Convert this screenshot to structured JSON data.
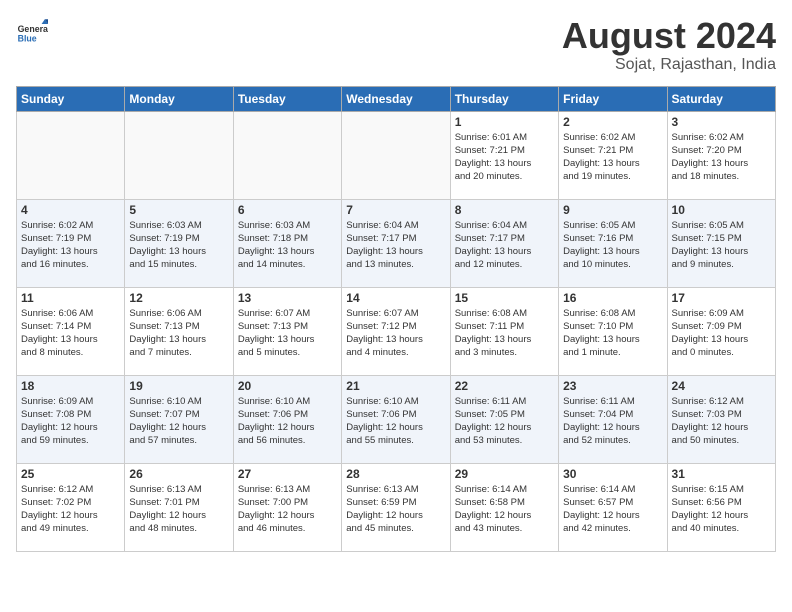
{
  "header": {
    "logo": {
      "general": "General",
      "blue": "Blue"
    },
    "title": "August 2024",
    "location": "Sojat, Rajasthan, India"
  },
  "days_of_week": [
    "Sunday",
    "Monday",
    "Tuesday",
    "Wednesday",
    "Thursday",
    "Friday",
    "Saturday"
  ],
  "weeks": [
    [
      {
        "day": "",
        "info": ""
      },
      {
        "day": "",
        "info": ""
      },
      {
        "day": "",
        "info": ""
      },
      {
        "day": "",
        "info": ""
      },
      {
        "day": "1",
        "info": "Sunrise: 6:01 AM\nSunset: 7:21 PM\nDaylight: 13 hours\nand 20 minutes."
      },
      {
        "day": "2",
        "info": "Sunrise: 6:02 AM\nSunset: 7:21 PM\nDaylight: 13 hours\nand 19 minutes."
      },
      {
        "day": "3",
        "info": "Sunrise: 6:02 AM\nSunset: 7:20 PM\nDaylight: 13 hours\nand 18 minutes."
      }
    ],
    [
      {
        "day": "4",
        "info": "Sunrise: 6:02 AM\nSunset: 7:19 PM\nDaylight: 13 hours\nand 16 minutes."
      },
      {
        "day": "5",
        "info": "Sunrise: 6:03 AM\nSunset: 7:19 PM\nDaylight: 13 hours\nand 15 minutes."
      },
      {
        "day": "6",
        "info": "Sunrise: 6:03 AM\nSunset: 7:18 PM\nDaylight: 13 hours\nand 14 minutes."
      },
      {
        "day": "7",
        "info": "Sunrise: 6:04 AM\nSunset: 7:17 PM\nDaylight: 13 hours\nand 13 minutes."
      },
      {
        "day": "8",
        "info": "Sunrise: 6:04 AM\nSunset: 7:17 PM\nDaylight: 13 hours\nand 12 minutes."
      },
      {
        "day": "9",
        "info": "Sunrise: 6:05 AM\nSunset: 7:16 PM\nDaylight: 13 hours\nand 10 minutes."
      },
      {
        "day": "10",
        "info": "Sunrise: 6:05 AM\nSunset: 7:15 PM\nDaylight: 13 hours\nand 9 minutes."
      }
    ],
    [
      {
        "day": "11",
        "info": "Sunrise: 6:06 AM\nSunset: 7:14 PM\nDaylight: 13 hours\nand 8 minutes."
      },
      {
        "day": "12",
        "info": "Sunrise: 6:06 AM\nSunset: 7:13 PM\nDaylight: 13 hours\nand 7 minutes."
      },
      {
        "day": "13",
        "info": "Sunrise: 6:07 AM\nSunset: 7:13 PM\nDaylight: 13 hours\nand 5 minutes."
      },
      {
        "day": "14",
        "info": "Sunrise: 6:07 AM\nSunset: 7:12 PM\nDaylight: 13 hours\nand 4 minutes."
      },
      {
        "day": "15",
        "info": "Sunrise: 6:08 AM\nSunset: 7:11 PM\nDaylight: 13 hours\nand 3 minutes."
      },
      {
        "day": "16",
        "info": "Sunrise: 6:08 AM\nSunset: 7:10 PM\nDaylight: 13 hours\nand 1 minute."
      },
      {
        "day": "17",
        "info": "Sunrise: 6:09 AM\nSunset: 7:09 PM\nDaylight: 13 hours\nand 0 minutes."
      }
    ],
    [
      {
        "day": "18",
        "info": "Sunrise: 6:09 AM\nSunset: 7:08 PM\nDaylight: 12 hours\nand 59 minutes."
      },
      {
        "day": "19",
        "info": "Sunrise: 6:10 AM\nSunset: 7:07 PM\nDaylight: 12 hours\nand 57 minutes."
      },
      {
        "day": "20",
        "info": "Sunrise: 6:10 AM\nSunset: 7:06 PM\nDaylight: 12 hours\nand 56 minutes."
      },
      {
        "day": "21",
        "info": "Sunrise: 6:10 AM\nSunset: 7:06 PM\nDaylight: 12 hours\nand 55 minutes."
      },
      {
        "day": "22",
        "info": "Sunrise: 6:11 AM\nSunset: 7:05 PM\nDaylight: 12 hours\nand 53 minutes."
      },
      {
        "day": "23",
        "info": "Sunrise: 6:11 AM\nSunset: 7:04 PM\nDaylight: 12 hours\nand 52 minutes."
      },
      {
        "day": "24",
        "info": "Sunrise: 6:12 AM\nSunset: 7:03 PM\nDaylight: 12 hours\nand 50 minutes."
      }
    ],
    [
      {
        "day": "25",
        "info": "Sunrise: 6:12 AM\nSunset: 7:02 PM\nDaylight: 12 hours\nand 49 minutes."
      },
      {
        "day": "26",
        "info": "Sunrise: 6:13 AM\nSunset: 7:01 PM\nDaylight: 12 hours\nand 48 minutes."
      },
      {
        "day": "27",
        "info": "Sunrise: 6:13 AM\nSunset: 7:00 PM\nDaylight: 12 hours\nand 46 minutes."
      },
      {
        "day": "28",
        "info": "Sunrise: 6:13 AM\nSunset: 6:59 PM\nDaylight: 12 hours\nand 45 minutes."
      },
      {
        "day": "29",
        "info": "Sunrise: 6:14 AM\nSunset: 6:58 PM\nDaylight: 12 hours\nand 43 minutes."
      },
      {
        "day": "30",
        "info": "Sunrise: 6:14 AM\nSunset: 6:57 PM\nDaylight: 12 hours\nand 42 minutes."
      },
      {
        "day": "31",
        "info": "Sunrise: 6:15 AM\nSunset: 6:56 PM\nDaylight: 12 hours\nand 40 minutes."
      }
    ]
  ]
}
